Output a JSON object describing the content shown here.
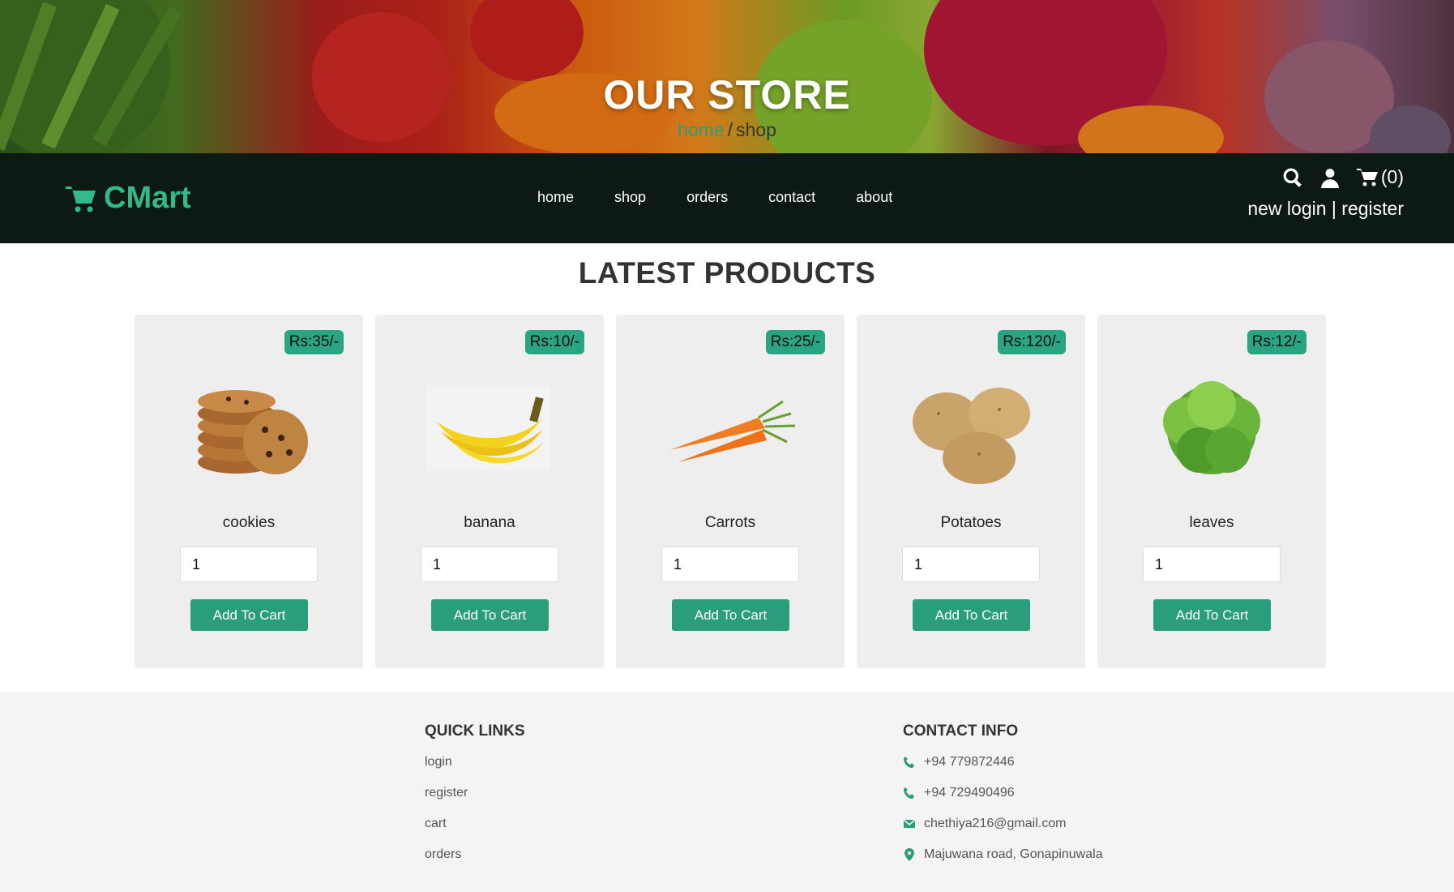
{
  "hero": {
    "title": "OUR STORE",
    "crumb_home": "home",
    "crumb_sep": "/",
    "crumb_shop": "shop"
  },
  "navbar": {
    "logo_text": "CMart",
    "links": [
      "home",
      "shop",
      "orders",
      "contact",
      "about"
    ],
    "cart_count": "(0)",
    "auth_new_login": "new login",
    "auth_sep": "|",
    "auth_register": "register",
    "icons": [
      "search-icon",
      "user-icon",
      "cart-icon"
    ]
  },
  "products_section": {
    "title": "LATEST PRODUCTS",
    "items": [
      {
        "name": "cookies",
        "price": "Rs:35/-",
        "qty": "1",
        "button": "Add To Cart",
        "icon": "cookies-image"
      },
      {
        "name": "banana",
        "price": "Rs:10/-",
        "qty": "1",
        "button": "Add To Cart",
        "icon": "banana-image"
      },
      {
        "name": "Carrots",
        "price": "Rs:25/-",
        "qty": "1",
        "button": "Add To Cart",
        "icon": "carrots-image"
      },
      {
        "name": "Potatoes",
        "price": "Rs:120/-",
        "qty": "1",
        "button": "Add To Cart",
        "icon": "potatoes-image"
      },
      {
        "name": "leaves",
        "price": "Rs:12/-",
        "qty": "1",
        "button": "Add To Cart",
        "icon": "leaves-image"
      }
    ]
  },
  "footer": {
    "quick_links_title": "QUICK LINKS",
    "quick_links": [
      "login",
      "register",
      "cart",
      "orders"
    ],
    "contact_title": "CONTACT INFO",
    "contacts": [
      {
        "icon": "phone-icon",
        "text": "+94 779872446"
      },
      {
        "icon": "phone-icon",
        "text": "+94 729490496"
      },
      {
        "icon": "envelope-icon",
        "text": "chethiya216@gmail.com"
      },
      {
        "icon": "map-marker-icon",
        "text": "Majuwana road, Gonapinuwala"
      }
    ]
  },
  "colors": {
    "accent": "#2a9d7c",
    "navbar_bg": "#0d1a14",
    "logo": "#33b98c",
    "card_bg": "#eeeeee",
    "footer_bg": "#f4f4f4"
  }
}
